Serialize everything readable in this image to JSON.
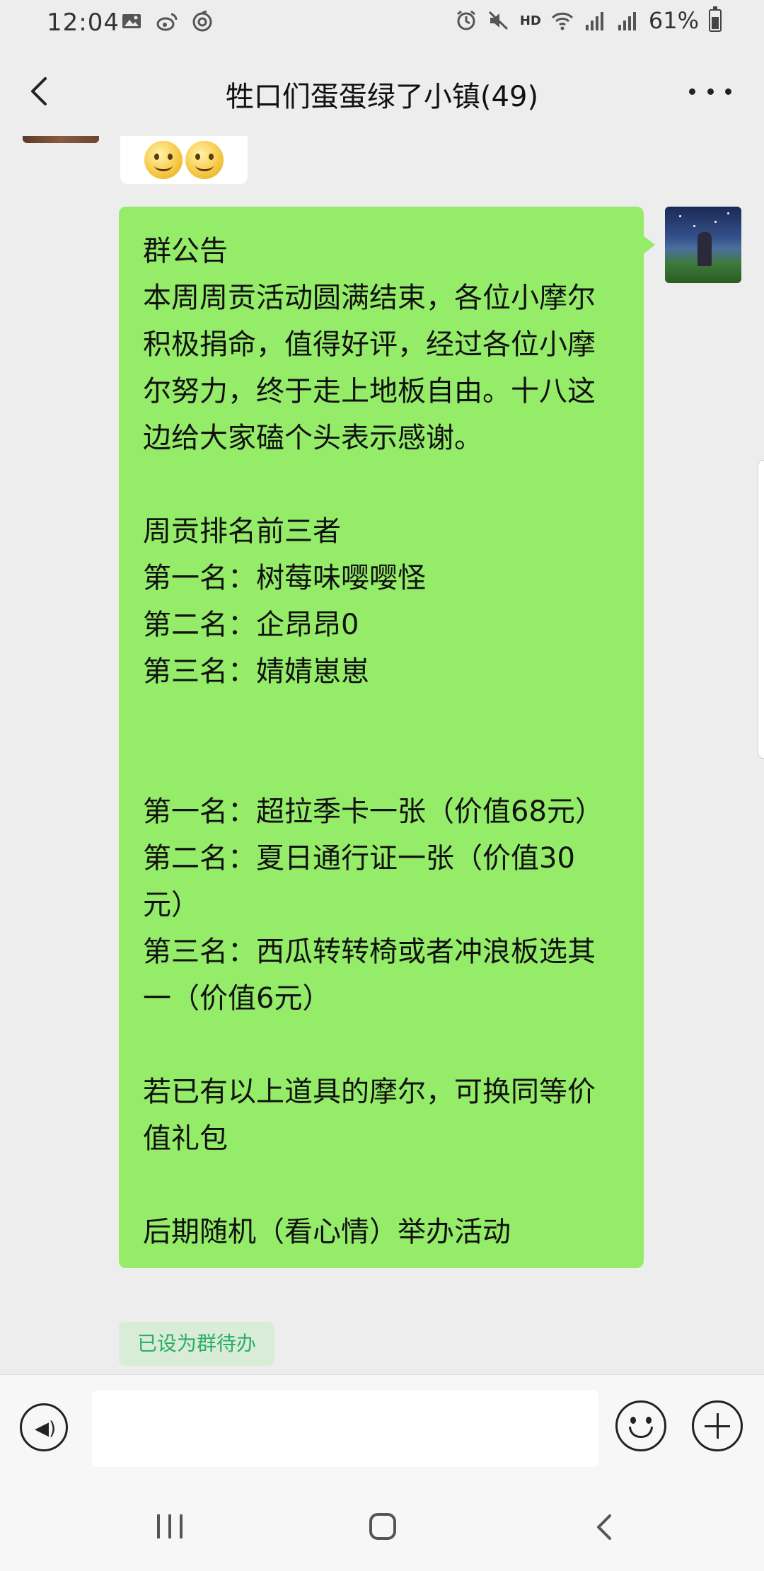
{
  "status_bar": {
    "time": "12:04",
    "left_icons": [
      "image-icon",
      "weibo-icon",
      "wallet-icon"
    ],
    "right_icons": [
      "alarm-icon",
      "mute-icon",
      "hd-icon",
      "wifi-icon",
      "signal-icon",
      "signal-icon"
    ],
    "hd_label": "HD",
    "battery_percent": "61%"
  },
  "header": {
    "title": "牲口们蛋蛋绿了小镇(49)"
  },
  "messages": {
    "incoming_emoji": [
      "smiley-emoji",
      "smiley-emoji"
    ],
    "announcement_text": "群公告\n本周周贡活动圆满结束，各位小摩尔积极捐命，值得好评，经过各位小摩尔努力，终于走上地板自由。十八这边给大家磕个头表示感谢。\n\n周贡排名前三者\n第一名：树莓味嘤嘤怪\n第二名：企昂昂0\n第三名：婧婧崽崽\n\n\n第一名：超拉季卡一张（价值68元）\n第二名：夏日通行证一张（价值30元）\n第三名：西瓜转转椅或者冲浪板选其一（价值6元）\n\n若已有以上道具的摩尔，可换同等价值礼包\n\n后期随机（看心情）举办活动",
    "todo_tag": "已设为群待办"
  },
  "input_bar": {
    "placeholder": ""
  },
  "colors": {
    "bubble_green": "#95ec69",
    "todo_green": "#2aae67",
    "background": "#ededed"
  }
}
